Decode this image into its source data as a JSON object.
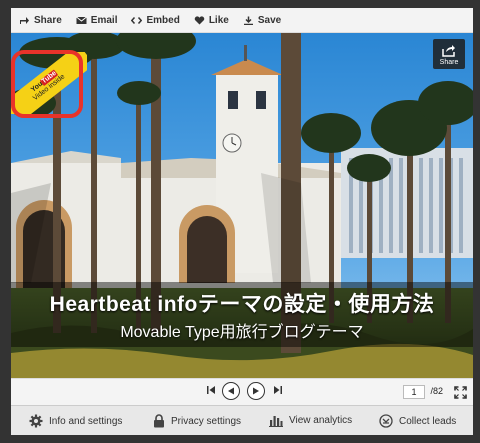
{
  "topbar": {
    "items": [
      {
        "label": "Share",
        "icon": "share-icon"
      },
      {
        "label": "Email",
        "icon": "envelope-icon"
      },
      {
        "label": "Embed",
        "icon": "code-icon"
      },
      {
        "label": "Like",
        "icon": "heart-icon"
      },
      {
        "label": "Save",
        "icon": "save-icon"
      }
    ]
  },
  "slide": {
    "title": "Heartbeat infoテーマの設定・使用方法",
    "subtitle": "Movable Type用旅行ブログテーマ",
    "share_button_label": "Share",
    "badge": {
      "you": "You",
      "tube": "Tube",
      "text": "Video inside"
    }
  },
  "navigation": {
    "current_page": "1",
    "total_pages": "/82"
  },
  "bottombar": {
    "info_label": "Info and settings",
    "privacy_label": "Privacy settings",
    "analytics_label": "View analytics",
    "leads_label": "Collect leads"
  },
  "colors": {
    "badge_ring": "#e8332a",
    "badge_fill": "#f5d116",
    "sky": "#2f8fd9"
  }
}
